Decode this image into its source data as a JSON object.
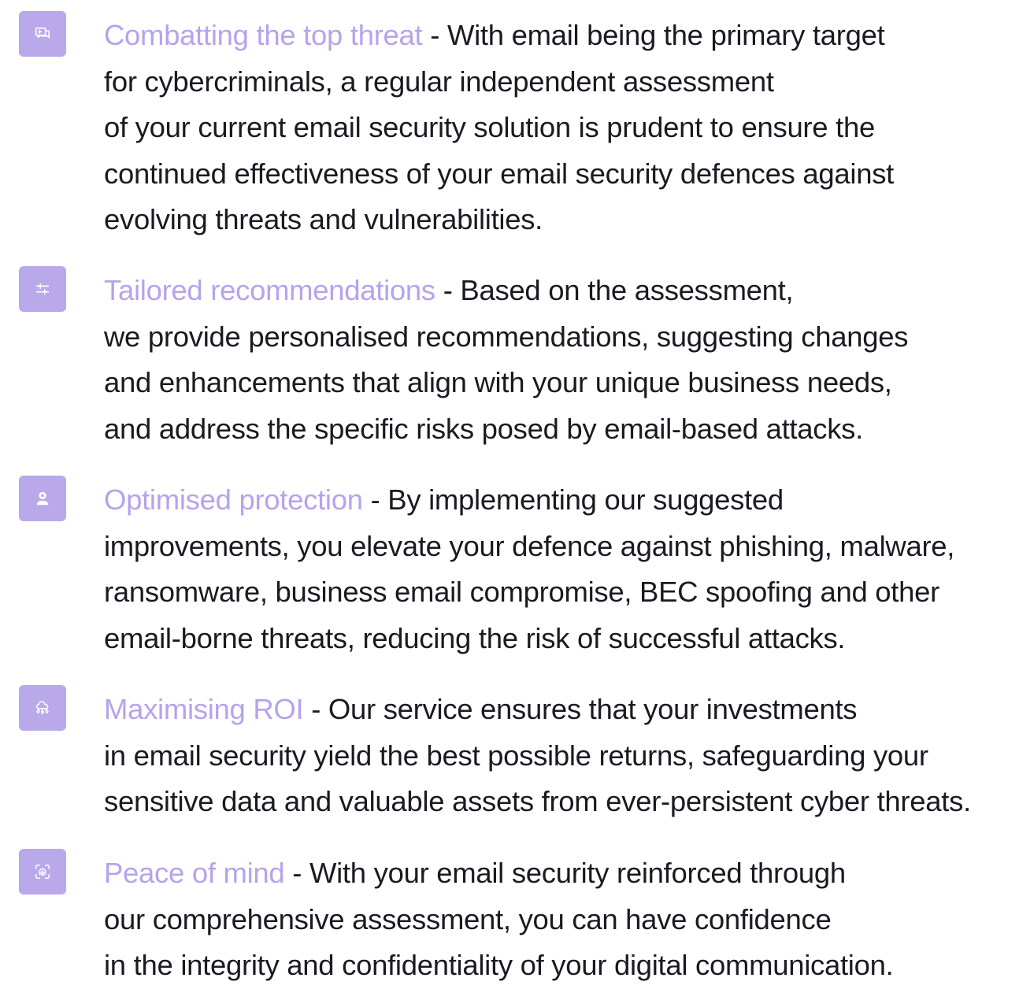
{
  "brand": {
    "accent": "#b6a3ec",
    "icon_background": "#b9a9ea",
    "text_color": "#1b1a22"
  },
  "benefits": [
    {
      "icon": "chat-icon",
      "title": "Combatting the top threat",
      "lines": [
        " - With email being the primary target",
        "for cybercriminals, a regular independent assessment",
        "of your current email security solution is prudent to ensure the",
        "continued effectiveness of your email security defences against",
        "evolving threats and vulnerabilities."
      ]
    },
    {
      "icon": "sliders-icon",
      "title": "Tailored recommendations",
      "lines": [
        " - Based on the assessment,",
        "we provide personalised recommendations, suggesting changes",
        "and enhancements that align with your unique business needs,",
        "and address the specific risks posed by email-based attacks."
      ]
    },
    {
      "icon": "user-shield-icon",
      "title": "Optimised protection",
      "lines": [
        " - By implementing our suggested",
        "improvements, you elevate your defence against phishing, malware,",
        "ransomware, business email compromise, BEC spoofing and other",
        "email-borne threats, reducing the risk of successful attacks."
      ]
    },
    {
      "icon": "cloud-network-icon",
      "title": "Maximising ROI",
      "lines": [
        " - Our service ensures that your investments",
        "in email security yield the best possible returns, safeguarding your",
        "sensitive data and valuable assets from ever-persistent cyber threats."
      ]
    },
    {
      "icon": "fingerprint-icon",
      "title": "Peace of mind",
      "lines": [
        " - With your email security reinforced through",
        "our comprehensive assessment, you can have confidence",
        "in the integrity and confidentiality of your digital communication."
      ]
    }
  ]
}
